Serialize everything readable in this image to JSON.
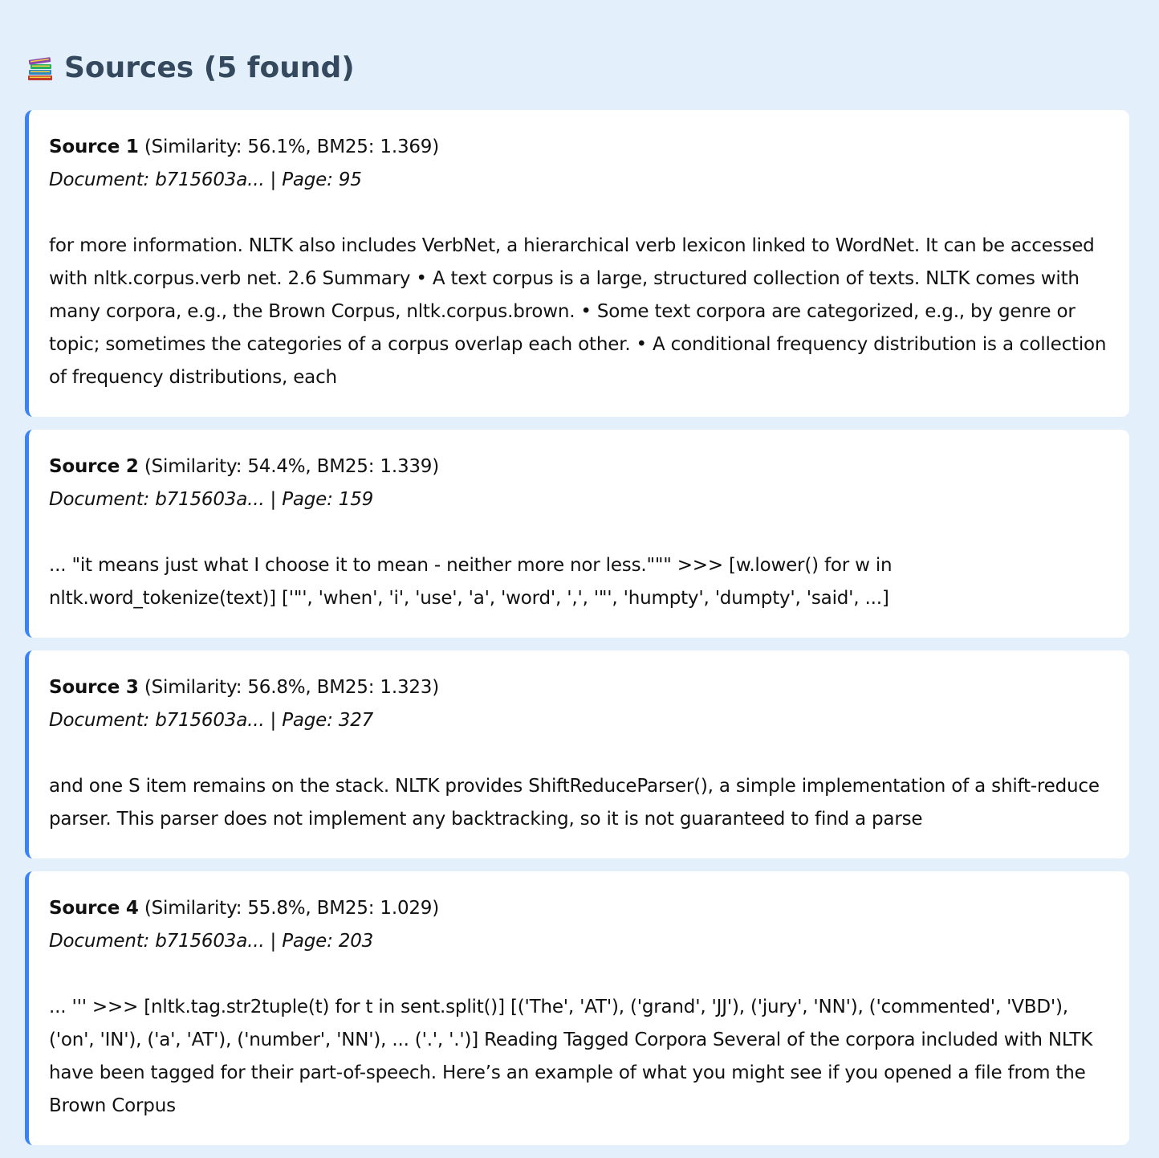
{
  "heading": {
    "icon": "books-icon",
    "text": "Sources (5 found)"
  },
  "sources": [
    {
      "title": "Source 1",
      "scores": "(Similarity: 56.1%, BM25: 1.369)",
      "meta": "Document: b715603a... | Page: 95",
      "text": "for more information. NLTK also includes VerbNet, a hierarchical verb lexicon linked to WordNet. It can be accessed with nltk.corpus.verb net. 2.6 Summary • A text corpus is a large, structured collection of texts. NLTK comes with many corpora, e.g., the Brown Corpus, nltk.corpus.brown. • Some text corpora are categorized, e.g., by genre or topic; sometimes the categories of a corpus overlap each other. • A conditional frequency distribution is a collection of frequency distributions, each"
    },
    {
      "title": "Source 2",
      "scores": "(Similarity: 54.4%, BM25: 1.339)",
      "meta": "Document: b715603a... | Page: 159",
      "text": "... \"it means just what I choose it to mean - neither more nor less.\"\"\" >>> [w.lower() for w in nltk.word_tokenize(text)] ['\"', 'when', 'i', 'use', 'a', 'word', ',', '\"', 'humpty', 'dumpty', 'said', ...]"
    },
    {
      "title": "Source 3",
      "scores": "(Similarity: 56.8%, BM25: 1.323)",
      "meta": "Document: b715603a... | Page: 327",
      "text": "and one S item remains on the stack. NLTK provides ShiftReduceParser(), a simple implementation of a shift-reduce parser. This parser does not implement any backtracking, so it is not guaranteed to find a parse"
    },
    {
      "title": "Source 4",
      "scores": "(Similarity: 55.8%, BM25: 1.029)",
      "meta": "Document: b715603a... | Page: 203",
      "text": "... ''' >>> [nltk.tag.str2tuple(t) for t in sent.split()] [('The', 'AT'), ('grand', 'JJ'), ('jury', 'NN'), ('commented', 'VBD'), ('on', 'IN'), ('a', 'AT'), ('number', 'NN'), ... ('.', '.')] Reading Tagged Corpora Several of the corpora included with NLTK have been tagged for their part-of-speech. Here’s an example of what you might see if you opened a file from the Brown Corpus"
    }
  ],
  "colors": {
    "page_background": "#e3f0fb",
    "card_accent": "#3b82f6",
    "heading_text": "#34495e"
  }
}
